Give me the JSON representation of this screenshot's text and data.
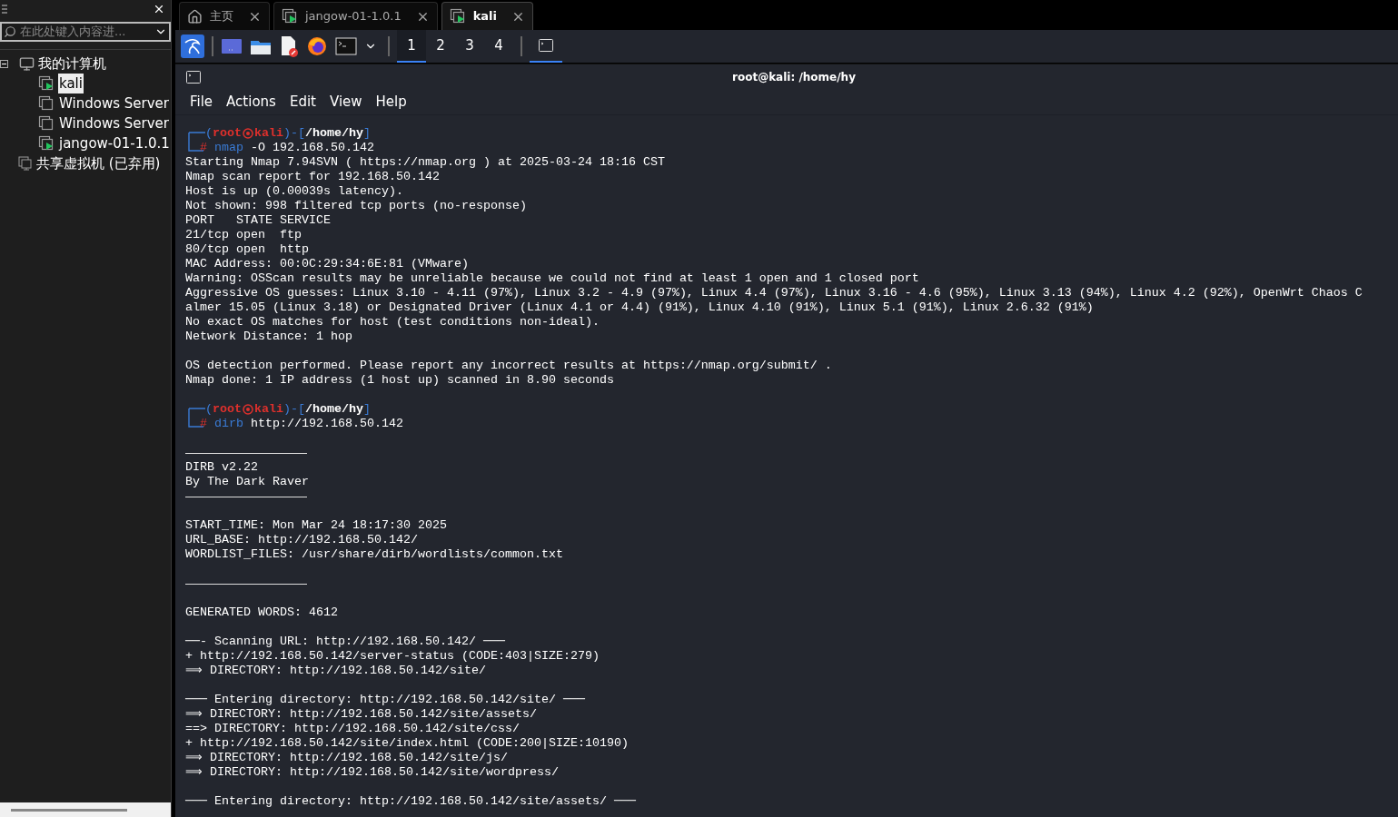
{
  "sidebar": {
    "search": {
      "placeholder": "在此处键入内容进..."
    },
    "tree": [
      {
        "label": "我的计算机",
        "kind": "computer",
        "expanded": true,
        "children": [
          {
            "label": "kali",
            "running": true,
            "selected": true
          },
          {
            "label": "Windows Server",
            "running": false,
            "selected": false
          },
          {
            "label": "Windows Server",
            "running": false,
            "selected": false
          },
          {
            "label": "jangow-01-1.0.1",
            "running": true,
            "selected": false
          }
        ]
      },
      {
        "label": "共享虚拟机 (已弃用)",
        "kind": "shared"
      }
    ]
  },
  "tabs": [
    {
      "label": "主页",
      "kind": "home",
      "selected": false
    },
    {
      "label": "jangow-01-1.0.1",
      "kind": "vm",
      "selected": false
    },
    {
      "label": "kali",
      "kind": "vm",
      "selected": true
    }
  ],
  "panel": {
    "workspaces": [
      {
        "label": "1",
        "selected": true
      },
      {
        "label": "2",
        "selected": false
      },
      {
        "label": "3",
        "selected": false
      },
      {
        "label": "4",
        "selected": false
      }
    ]
  },
  "terminal": {
    "title": "root@kali: /home/hy",
    "menu": [
      "File",
      "Actions",
      "Edit",
      "View",
      "Help"
    ],
    "lines": [
      {
        "kind": "prompt",
        "open": "(",
        "user": "root",
        "host": "kali",
        "mid": ")-[",
        "path": "/home/hy",
        "close": "]",
        "mark": "#",
        "command": "nmap",
        "args": "-O 192.168.50.142"
      },
      {
        "kind": "text",
        "text": "Starting Nmap 7.94SVN ( https://nmap.org ) at 2025-03-24 18:16 CST"
      },
      {
        "kind": "text",
        "text": "Nmap scan report for 192.168.50.142"
      },
      {
        "kind": "text",
        "text": "Host is up (0.00039s latency)."
      },
      {
        "kind": "text",
        "text": "Not shown: 998 filtered tcp ports (no-response)"
      },
      {
        "kind": "text",
        "text": "PORT   STATE SERVICE"
      },
      {
        "kind": "text",
        "text": "21/tcp open  ftp"
      },
      {
        "kind": "text",
        "text": "80/tcp open  http"
      },
      {
        "kind": "text",
        "text": "MAC Address: 00:0C:29:34:6E:81 (VMware)"
      },
      {
        "kind": "text",
        "text": "Warning: OSScan results may be unreliable because we could not find at least 1 open and 1 closed port"
      },
      {
        "kind": "text",
        "text": "Aggressive OS guesses: Linux 3.10 - 4.11 (97%), Linux 3.2 - 4.9 (97%), Linux 4.4 (97%), Linux 3.16 - 4.6 (95%), Linux 3.13 (94%), Linux 4.2 (92%), OpenWrt Chaos C"
      },
      {
        "kind": "text",
        "text": "almer 15.05 (Linux 3.18) or Designated Driver (Linux 4.1 or 4.4) (91%), Linux 4.10 (91%), Linux 5.1 (91%), Linux 2.6.32 (91%)"
      },
      {
        "kind": "text",
        "text": "No exact OS matches for host (test conditions non-ideal)."
      },
      {
        "kind": "text",
        "text": "Network Distance: 1 hop"
      },
      {
        "kind": "blank"
      },
      {
        "kind": "text",
        "text": "OS detection performed. Please report any incorrect results at https://nmap.org/submit/ ."
      },
      {
        "kind": "text",
        "text": "Nmap done: 1 IP address (1 host up) scanned in 8.90 seconds"
      },
      {
        "kind": "blank"
      },
      {
        "kind": "prompt",
        "open": "(",
        "user": "root",
        "host": "kali",
        "mid": ")-[",
        "path": "/home/hy",
        "close": "]",
        "mark": "#",
        "command": "dirb",
        "args": "http://192.168.50.142"
      },
      {
        "kind": "blank"
      },
      {
        "kind": "rule"
      },
      {
        "kind": "text",
        "text": "DIRB v2.22"
      },
      {
        "kind": "text",
        "text": "By The Dark Raver"
      },
      {
        "kind": "rule"
      },
      {
        "kind": "blank"
      },
      {
        "kind": "text",
        "text": "START_TIME: Mon Mar 24 18:17:30 2025"
      },
      {
        "kind": "text",
        "text": "URL_BASE: http://192.168.50.142/"
      },
      {
        "kind": "text",
        "text": "WORDLIST_FILES: /usr/share/dirb/wordlists/common.txt"
      },
      {
        "kind": "blank"
      },
      {
        "kind": "rule"
      },
      {
        "kind": "blank"
      },
      {
        "kind": "text",
        "text": "GENERATED WORDS: 4612"
      },
      {
        "kind": "blank"
      },
      {
        "kind": "text",
        "text": "──- Scanning URL: http://192.168.50.142/ ───"
      },
      {
        "kind": "text",
        "text": "+ http://192.168.50.142/server-status (CODE:403|SIZE:279)"
      },
      {
        "kind": "text",
        "text": "⟹ DIRECTORY: http://192.168.50.142/site/"
      },
      {
        "kind": "blank"
      },
      {
        "kind": "text",
        "text": "─── Entering directory: http://192.168.50.142/site/ ───"
      },
      {
        "kind": "text",
        "text": "⟹ DIRECTORY: http://192.168.50.142/site/assets/"
      },
      {
        "kind": "text",
        "text": "==> DIRECTORY: http://192.168.50.142/site/css/"
      },
      {
        "kind": "text",
        "text": "+ http://192.168.50.142/site/index.html (CODE:200|SIZE:10190)"
      },
      {
        "kind": "text",
        "text": "⟹ DIRECTORY: http://192.168.50.142/site/js/"
      },
      {
        "kind": "text",
        "text": "⟹ DIRECTORY: http://192.168.50.142/site/wordpress/"
      },
      {
        "kind": "blank"
      },
      {
        "kind": "text",
        "text": "─── Entering directory: http://192.168.50.142/site/assets/ ───"
      }
    ]
  }
}
